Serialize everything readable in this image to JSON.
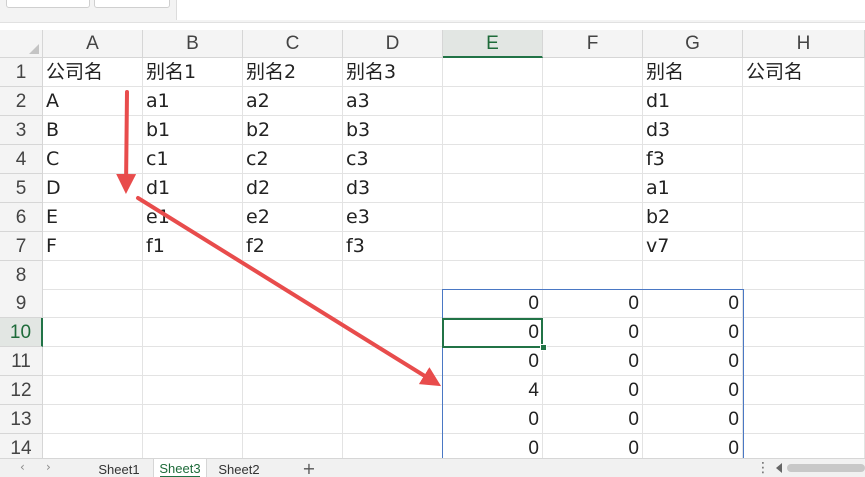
{
  "sheet": {
    "columns": [
      "A",
      "B",
      "C",
      "D",
      "E",
      "F",
      "G",
      "H"
    ],
    "rows": [
      "1",
      "2",
      "3",
      "4",
      "5",
      "6",
      "7",
      "8",
      "9",
      "10",
      "11",
      "12",
      "13",
      "14"
    ],
    "active_column": "E",
    "active_row": "10",
    "cells": {
      "A1": "公司名",
      "B1": "别名1",
      "C1": "别名2",
      "D1": "别名3",
      "G1": "别名",
      "H1": "公司名",
      "A2": "A",
      "B2": "a1",
      "C2": "a2",
      "D2": "a3",
      "G2": "d1",
      "A3": "B",
      "B3": "b1",
      "C3": "b2",
      "D3": "b3",
      "G3": "d3",
      "A4": "C",
      "B4": "c1",
      "C4": "c2",
      "D4": "c3",
      "G4": "f3",
      "A5": "D",
      "B5": "d1",
      "C5": "d2",
      "D5": "d3",
      "G5": "a1",
      "A6": "E",
      "B6": "e1",
      "C6": "e2",
      "D6": "e3",
      "G6": "b2",
      "A7": "F",
      "B7": "f1",
      "C7": "f2",
      "D7": "f3",
      "G7": "v7",
      "E9": "0",
      "F9": "0",
      "G9": "0",
      "E10": "0",
      "F10": "0",
      "G10": "0",
      "E11": "0",
      "F11": "0",
      "G11": "0",
      "E12": "4",
      "F12": "0",
      "G12": "0",
      "E13": "0",
      "F13": "0",
      "G13": "0",
      "E14": "0",
      "F14": "0",
      "G14": "0"
    }
  },
  "tabs": {
    "sheets": [
      {
        "label": "Sheet1",
        "active": false
      },
      {
        "label": "Sheet3",
        "active": true
      },
      {
        "label": "Sheet2",
        "active": false
      }
    ],
    "add_label": "+",
    "more_label": "⋮"
  },
  "colors": {
    "accent": "#217346",
    "annotation_arrow": "#e84c4c",
    "selection_border": "#4a78c4"
  },
  "icons": [
    "nav-left-icon",
    "nav-right-icon",
    "add-sheet-icon",
    "more-icon",
    "scroll-left-icon",
    "arrow-annotation"
  ]
}
